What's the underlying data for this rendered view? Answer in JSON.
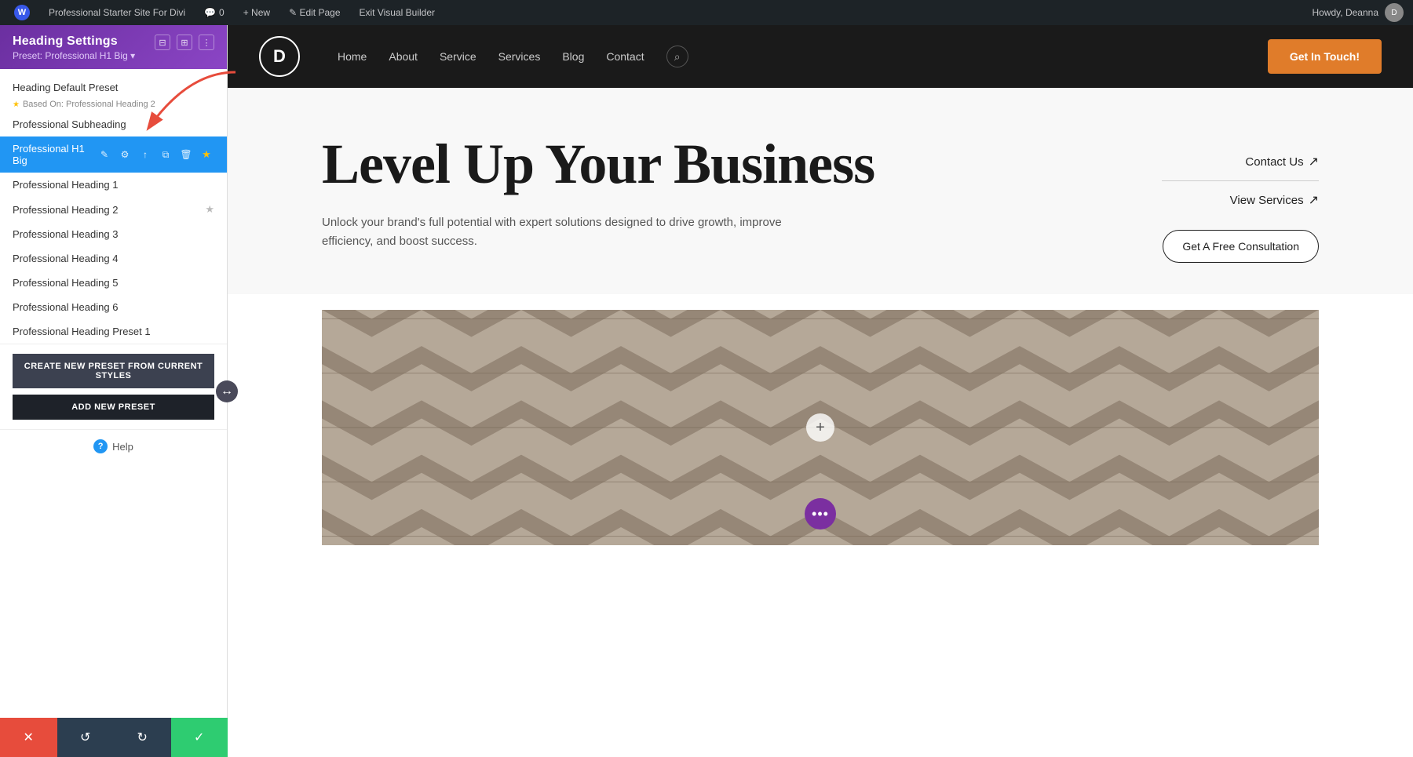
{
  "adminBar": {
    "wpLogo": "W",
    "siteName": "Professional Starter Site For Divi",
    "commentCount": "0",
    "newLabel": "+ New",
    "editPageLabel": "✎ Edit Page",
    "exitBuilderLabel": "Exit Visual Builder",
    "howdyText": "Howdy, Deanna",
    "avatarInitial": "D"
  },
  "sidebar": {
    "title": "Heading Settings",
    "presetLabel": "Preset: Professional H1 Big ▾",
    "collapseIcon": "⊟",
    "moreIcon": "⋮",
    "defaultPreset": "Heading Default Preset",
    "basedOnLabel": "Based On: Professional Heading 2",
    "items": [
      {
        "id": "subheading",
        "label": "Professional Subheading",
        "active": false,
        "starred": false
      },
      {
        "id": "h1big",
        "label": "Professional H1 Big",
        "active": true,
        "starred": true
      },
      {
        "id": "heading1",
        "label": "Professional Heading 1",
        "active": false,
        "starred": false
      },
      {
        "id": "heading2",
        "label": "Professional Heading 2",
        "active": false,
        "starred": true
      },
      {
        "id": "heading3",
        "label": "Professional Heading 3",
        "active": false,
        "starred": false
      },
      {
        "id": "heading4",
        "label": "Professional Heading 4",
        "active": false,
        "starred": false
      },
      {
        "id": "heading5",
        "label": "Professional Heading 5",
        "active": false,
        "starred": false
      },
      {
        "id": "heading6",
        "label": "Professional Heading 6",
        "active": false,
        "starred": false
      },
      {
        "id": "preset1",
        "label": "Professional Heading Preset 1",
        "active": false,
        "starred": false
      }
    ],
    "createPresetBtn": "CREATE NEW PRESET FROM CURRENT STYLES",
    "addPresetBtn": "ADD NEW PRESET",
    "helpLabel": "Help"
  },
  "bottomBar": {
    "cancelIcon": "✕",
    "undoIcon": "↺",
    "redoIcon": "↻",
    "saveIcon": "✓"
  },
  "siteNav": {
    "logoLetter": "D",
    "links": [
      "Home",
      "About",
      "Service",
      "Services",
      "Blog",
      "Contact"
    ],
    "searchIcon": "🔍",
    "ctaButton": "Get In Touch!"
  },
  "hero": {
    "heading": "Level Up Your Business",
    "subtext": "Unlock your brand's full potential with expert solutions designed to drive growth, improve efficiency, and boost success.",
    "cta1": "Contact Us",
    "cta2": "View Services",
    "cta3": "Get A Free Consultation"
  },
  "colors": {
    "purple": "#6b2fa0",
    "orange": "#e07c2a",
    "blue": "#2196f3",
    "green": "#2ecc71",
    "red": "#e74c3c",
    "darkNav": "#1a1a1a"
  }
}
